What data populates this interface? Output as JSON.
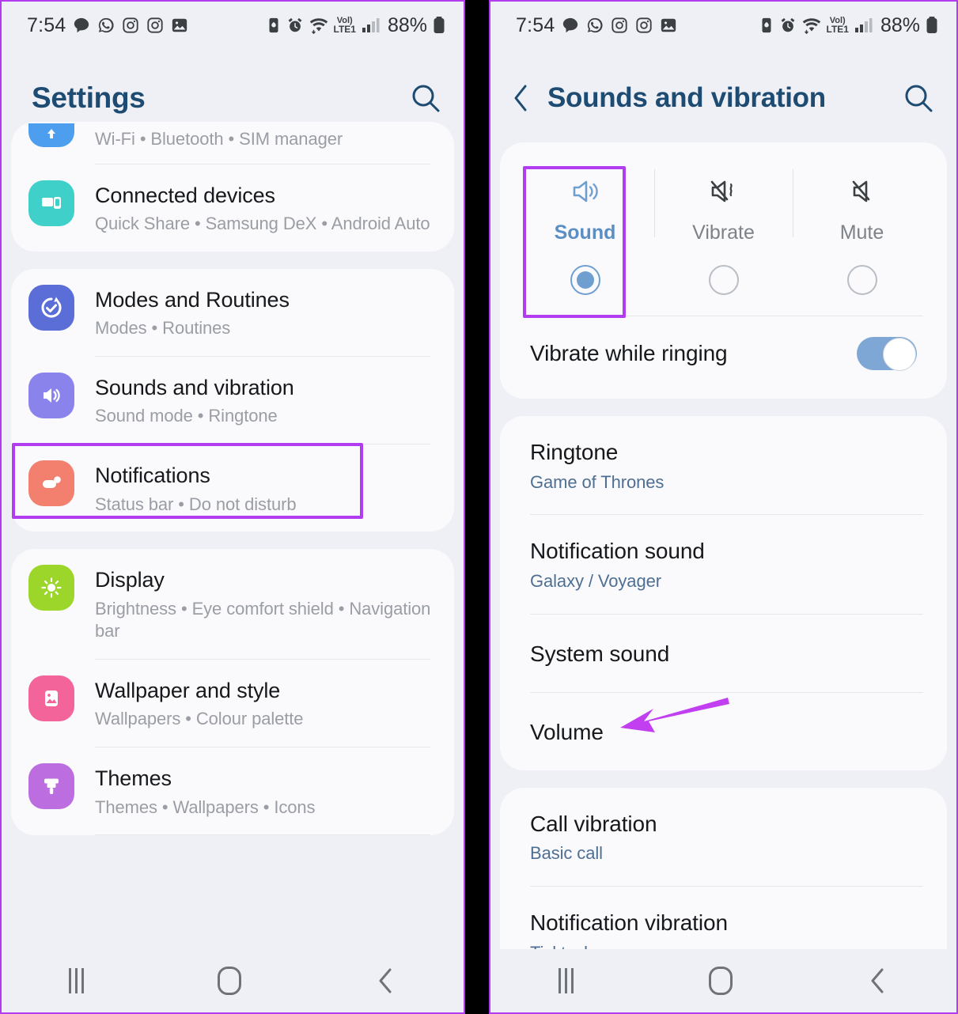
{
  "theme": {
    "accent_blue": "#1d4b72",
    "highlight_purple": "#b23cf0",
    "sub_blue": "#4f6f92",
    "toggle_on": "#7ea7d6"
  },
  "status_bar": {
    "time": "7:54",
    "battery_percent": "88%",
    "network_label": "LTE1",
    "volte_label": "Vol)",
    "left_icons": [
      "message-bubble-icon",
      "whatsapp-icon",
      "instagram-icon",
      "instagram-icon",
      "gallery-icon"
    ],
    "right_icons": [
      "battery-saver-icon",
      "alarm-icon",
      "wifi-icon",
      "volte-icon",
      "signal-icon",
      "battery-icon"
    ]
  },
  "left_panel": {
    "title": "Settings",
    "search_icon": "search-icon",
    "groups": [
      {
        "items": [
          {
            "title": "",
            "subtitle": "Wi-Fi  •  Bluetooth  •  SIM manager",
            "icon": "connections-icon",
            "icon_color": "#4e9ef0",
            "clipped": true
          },
          {
            "title": "Connected devices",
            "subtitle": "Quick Share  •  Samsung DeX  •  Android Auto",
            "icon": "connected-devices-icon",
            "icon_color": "#3fd0c9"
          }
        ]
      },
      {
        "items": [
          {
            "title": "Modes and Routines",
            "subtitle": "Modes  •  Routines",
            "icon": "modes-routines-icon",
            "icon_color": "#5b6ed8"
          },
          {
            "title": "Sounds and vibration",
            "subtitle": "Sound mode  •  Ringtone",
            "icon": "sound-icon",
            "icon_color": "#8b83ec",
            "highlighted": true
          },
          {
            "title": "Notifications",
            "subtitle": "Status bar  •  Do not disturb",
            "icon": "notifications-icon",
            "icon_color": "#f3806f"
          }
        ]
      },
      {
        "items": [
          {
            "title": "Display",
            "subtitle": "Brightness  •  Eye comfort shield  •  Navigation bar",
            "icon": "display-icon",
            "icon_color": "#9cd62b"
          },
          {
            "title": "Wallpaper and style",
            "subtitle": "Wallpapers  •  Colour palette",
            "icon": "wallpaper-icon",
            "icon_color": "#f2649a"
          },
          {
            "title": "Themes",
            "subtitle": "Themes  •  Wallpapers  •  Icons",
            "icon": "themes-icon",
            "icon_color": "#bc6ee0"
          }
        ]
      }
    ]
  },
  "right_panel": {
    "title": "Sounds and vibration",
    "back_icon": "back-chevron-icon",
    "search_icon": "search-icon",
    "sound_modes": [
      {
        "label": "Sound",
        "icon": "speaker-on-icon",
        "selected": true,
        "highlighted": true
      },
      {
        "label": "Vibrate",
        "icon": "speaker-vibrate-icon",
        "selected": false,
        "highlighted": false
      },
      {
        "label": "Mute",
        "icon": "speaker-mute-icon",
        "selected": false,
        "highlighted": false
      }
    ],
    "vibrate_while_ringing": {
      "label": "Vibrate while ringing",
      "enabled": true
    },
    "sound_items": [
      {
        "title": "Ringtone",
        "subtitle": "Game of Thrones"
      },
      {
        "title": "Notification sound",
        "subtitle": "Galaxy / Voyager"
      },
      {
        "title": "System sound",
        "subtitle": ""
      },
      {
        "title": "Volume",
        "subtitle": "",
        "annotated": true
      }
    ],
    "vibration_items": [
      {
        "title": "Call vibration",
        "subtitle": "Basic call"
      },
      {
        "title": "Notification vibration",
        "subtitle": "Ticktock"
      }
    ]
  },
  "nav_bar": {
    "recents": "recents-icon",
    "home": "home-icon",
    "back": "back-icon"
  }
}
